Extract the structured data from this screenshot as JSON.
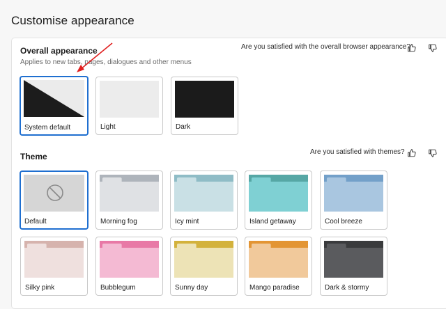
{
  "page": {
    "title": "Customise appearance"
  },
  "overall": {
    "title": "Overall appearance",
    "subtitle": "Applies to new tabs, pages, dialogues and other menus",
    "feedback_question": "Are you satisfied with the overall browser appearance?",
    "options": [
      {
        "label": "System default",
        "selected": true
      },
      {
        "label": "Light",
        "selected": false
      },
      {
        "label": "Dark",
        "selected": false
      }
    ]
  },
  "theme": {
    "title": "Theme",
    "feedback_question": "Are you satisfied with themes?",
    "options": [
      {
        "label": "Default",
        "selected": true,
        "tab": "#d6d6d6",
        "body": "#d6d6d6"
      },
      {
        "label": "Morning fog",
        "selected": false,
        "tab": "#aeb4bb",
        "body": "#dfe1e4"
      },
      {
        "label": "Icy mint",
        "selected": false,
        "tab": "#8fbcc6",
        "body": "#c9e0e5"
      },
      {
        "label": "Island getaway",
        "selected": false,
        "tab": "#56a7a5",
        "body": "#7fd0d3"
      },
      {
        "label": "Cool breeze",
        "selected": false,
        "tab": "#73a0c9",
        "body": "#a9c6e0"
      },
      {
        "label": "Silky pink",
        "selected": false,
        "tab": "#d6b3ad",
        "body": "#efe0de"
      },
      {
        "label": "Bubblegum",
        "selected": false,
        "tab": "#e879a6",
        "body": "#f4bad3"
      },
      {
        "label": "Sunny day",
        "selected": false,
        "tab": "#d3b23c",
        "body": "#ede3b6"
      },
      {
        "label": "Mango paradise",
        "selected": false,
        "tab": "#e39534",
        "body": "#f1c99b"
      },
      {
        "label": "Dark & stormy",
        "selected": false,
        "tab": "#3a3b3d",
        "body": "#5a5b5e"
      }
    ]
  },
  "colors": {
    "accent": "#1f6fd0",
    "annotation_arrow": "#e02020"
  }
}
